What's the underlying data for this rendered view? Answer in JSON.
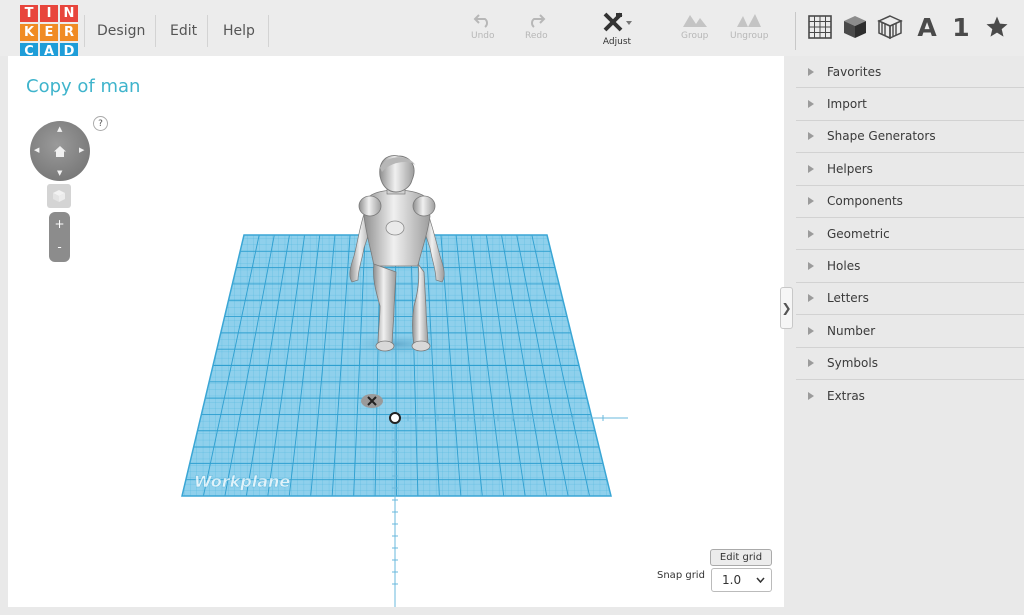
{
  "app": {
    "logo_letters": [
      "T",
      "I",
      "N",
      "K",
      "E",
      "R",
      "C",
      "A",
      "D"
    ],
    "logo_colors": [
      "#e8453c",
      "#e8453c",
      "#e8453c",
      "#f08b24",
      "#f08b24",
      "#f08b24",
      "#1e9dd8",
      "#1e9dd8",
      "#1e9dd8"
    ]
  },
  "menu": {
    "design": "Design",
    "edit": "Edit",
    "help": "Help"
  },
  "toolbar": {
    "undo": "Undo",
    "redo": "Redo",
    "adjust": "Adjust",
    "group": "Group",
    "ungroup": "Ungroup",
    "undo_icon": "undo-icon",
    "redo_icon": "redo-icon",
    "adjust_icon": "adjust-icon",
    "group_icon": "group-icon",
    "ungroup_icon": "ungroup-icon"
  },
  "shape_tabs": {
    "text_letter": "A",
    "number_digit": "1"
  },
  "viewport": {
    "title": "Copy of man",
    "help": "?",
    "zoom_in": "+",
    "zoom_out": "-",
    "workplane_label": "Workplane",
    "edit_grid": "Edit grid",
    "snap_grid_label": "Snap grid",
    "snap_grid_value": "1.0"
  },
  "sidebar": {
    "toggle": "❯",
    "categories": [
      "Favorites",
      "Import",
      "Shape Generators",
      "Helpers",
      "Components",
      "Geometric",
      "Holes",
      "Letters",
      "Number",
      "Symbols",
      "Extras"
    ]
  },
  "colors": {
    "accent": "#3fb4cc",
    "grid": "#7dc7e6",
    "grid_line": "#3aa6d5",
    "model": "#c9c9c9"
  }
}
